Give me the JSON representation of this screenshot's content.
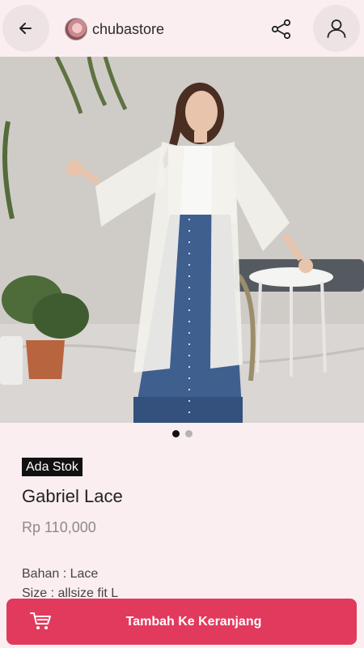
{
  "header": {
    "store_name": "chubastore",
    "back_icon": "arrow-left-icon",
    "share_icon": "share-icon",
    "account_icon": "user-icon"
  },
  "gallery": {
    "image_count": 2,
    "active_index": 0
  },
  "product": {
    "stock_badge": "Ada Stok",
    "name": "Gabriel Lace",
    "price": "Rp 110,000",
    "description_lines": [
      "Bahan : Lace",
      "Size : allsize fit L"
    ]
  },
  "cart": {
    "label": "Tambah Ke Keranjang",
    "icon": "cart-icon",
    "color": "#e23a5c"
  }
}
